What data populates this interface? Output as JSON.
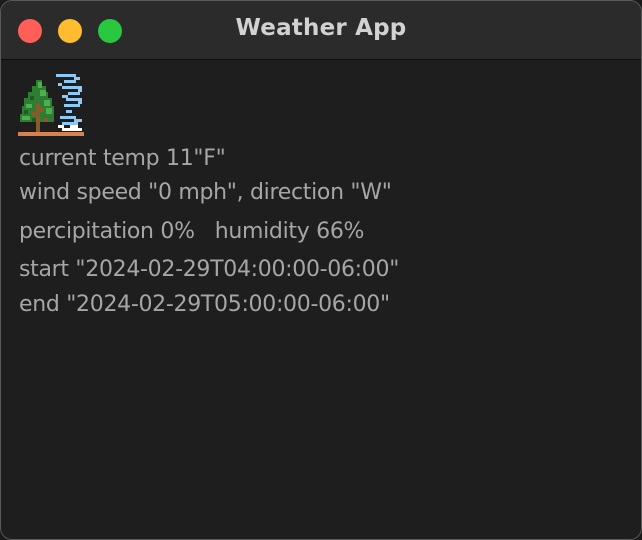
{
  "window": {
    "title": "Weather App"
  },
  "icon": {
    "name": "tree-wind-icon"
  },
  "weather": {
    "current_temp": "current temp 11\"F\"",
    "wind": "wind speed \"0 mph\", direction \"W\"",
    "precipitation": "percipitation 0%",
    "humidity": "humidity 66%",
    "start": "start \"2024-02-29T04:00:00-06:00\"",
    "end": "end \"2024-02-29T05:00:00-06:00\""
  },
  "colors": {
    "close": "#ff5f57",
    "minimize": "#febc2e",
    "maximize": "#28c840",
    "text": "#a6a6a6"
  }
}
